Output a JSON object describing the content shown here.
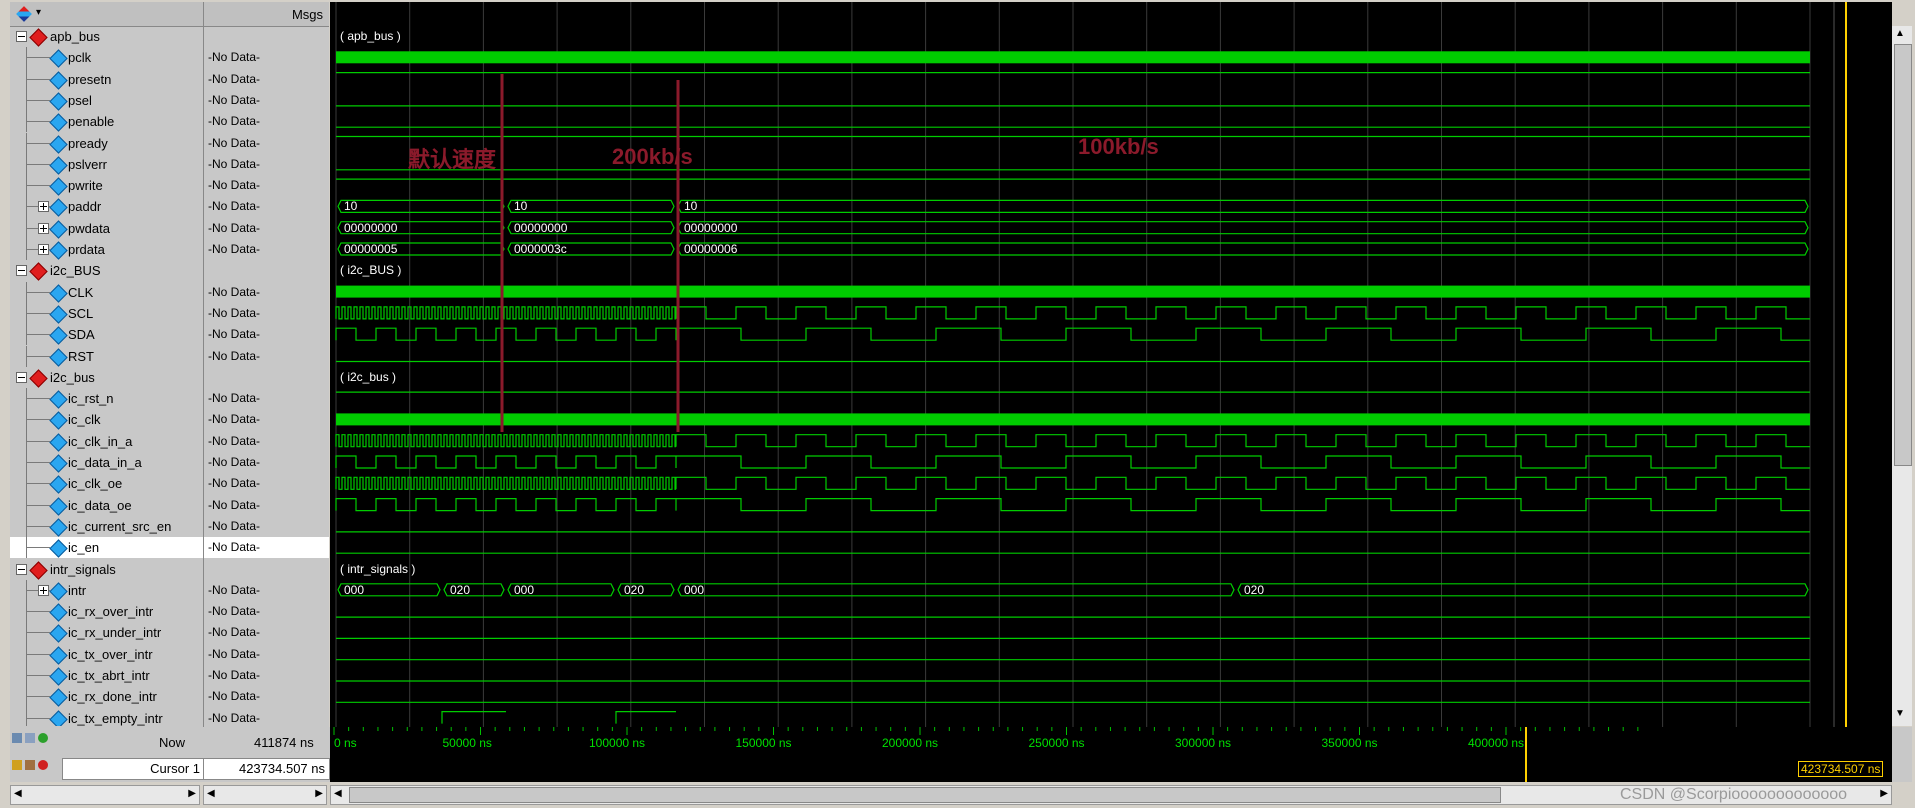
{
  "header": {
    "msgs_title": "Msgs"
  },
  "signals": [
    {
      "name": "apb_bus",
      "msg": "",
      "kind": "group",
      "expand": "minus",
      "indent": 0
    },
    {
      "name": "pclk",
      "msg": "-No Data-",
      "kind": "signal",
      "indent": 1
    },
    {
      "name": "presetn",
      "msg": "-No Data-",
      "kind": "signal",
      "indent": 1
    },
    {
      "name": "psel",
      "msg": "-No Data-",
      "kind": "signal",
      "indent": 1
    },
    {
      "name": "penable",
      "msg": "-No Data-",
      "kind": "signal",
      "indent": 1
    },
    {
      "name": "pready",
      "msg": "-No Data-",
      "kind": "signal",
      "indent": 1
    },
    {
      "name": "pslverr",
      "msg": "-No Data-",
      "kind": "signal",
      "indent": 1
    },
    {
      "name": "pwrite",
      "msg": "-No Data-",
      "kind": "signal",
      "indent": 1
    },
    {
      "name": "paddr",
      "msg": "-No Data-",
      "kind": "signal",
      "expand": "plus",
      "indent": 1
    },
    {
      "name": "pwdata",
      "msg": "-No Data-",
      "kind": "signal",
      "expand": "plus",
      "indent": 1
    },
    {
      "name": "prdata",
      "msg": "-No Data-",
      "kind": "signal",
      "expand": "plus",
      "indent": 1
    },
    {
      "name": "i2c_BUS",
      "msg": "",
      "kind": "group",
      "expand": "minus",
      "indent": 0
    },
    {
      "name": "CLK",
      "msg": "-No Data-",
      "kind": "signal",
      "indent": 1
    },
    {
      "name": "SCL",
      "msg": "-No Data-",
      "kind": "signal",
      "indent": 1
    },
    {
      "name": "SDA",
      "msg": "-No Data-",
      "kind": "signal",
      "indent": 1
    },
    {
      "name": "RST",
      "msg": "-No Data-",
      "kind": "signal",
      "indent": 1
    },
    {
      "name": "i2c_bus",
      "msg": "",
      "kind": "group",
      "expand": "minus",
      "indent": 0
    },
    {
      "name": "ic_rst_n",
      "msg": "-No Data-",
      "kind": "signal",
      "indent": 1
    },
    {
      "name": "ic_clk",
      "msg": "-No Data-",
      "kind": "signal",
      "indent": 1
    },
    {
      "name": "ic_clk_in_a",
      "msg": "-No Data-",
      "kind": "signal",
      "indent": 1
    },
    {
      "name": "ic_data_in_a",
      "msg": "-No Data-",
      "kind": "signal",
      "indent": 1
    },
    {
      "name": "ic_clk_oe",
      "msg": "-No Data-",
      "kind": "signal",
      "indent": 1
    },
    {
      "name": "ic_data_oe",
      "msg": "-No Data-",
      "kind": "signal",
      "indent": 1
    },
    {
      "name": "ic_current_src_en",
      "msg": "-No Data-",
      "kind": "signal",
      "indent": 1
    },
    {
      "name": "ic_en",
      "msg": "-No Data-",
      "kind": "signal",
      "indent": 1,
      "selected": true
    },
    {
      "name": "intr_signals",
      "msg": "",
      "kind": "group",
      "expand": "minus",
      "indent": 0
    },
    {
      "name": "intr",
      "msg": "-No Data-",
      "kind": "signal",
      "expand": "plus",
      "indent": 1
    },
    {
      "name": "ic_rx_over_intr",
      "msg": "-No Data-",
      "kind": "signal",
      "indent": 1
    },
    {
      "name": "ic_rx_under_intr",
      "msg": "-No Data-",
      "kind": "signal",
      "indent": 1
    },
    {
      "name": "ic_tx_over_intr",
      "msg": "-No Data-",
      "kind": "signal",
      "indent": 1
    },
    {
      "name": "ic_tx_abrt_intr",
      "msg": "-No Data-",
      "kind": "signal",
      "indent": 1
    },
    {
      "name": "ic_rx_done_intr",
      "msg": "-No Data-",
      "kind": "signal",
      "indent": 1
    },
    {
      "name": "ic_tx_empty_intr",
      "msg": "-No Data-",
      "kind": "signal",
      "indent": 1
    }
  ],
  "group_labels": {
    "apb_bus": "( apb_bus )",
    "i2c_BUS": "( i2c_BUS )",
    "i2c_bus": "( i2c_bus )",
    "intr_signals": "( intr_signals )"
  },
  "bus_values": {
    "paddr": [
      "10",
      "10",
      "10"
    ],
    "pwdata": [
      "00000000",
      "00000000",
      "00000000"
    ],
    "prdata": [
      "00000005",
      "0000003c",
      "00000006"
    ],
    "intr": [
      "000",
      "020",
      "000",
      "020",
      "000",
      "020"
    ]
  },
  "annotations": {
    "default_speed": "默认速度",
    "speed_200": "200kb/s",
    "speed_100": "100kb/s"
  },
  "annotation_color": "#8b1a2b",
  "status": {
    "now_label": "Now",
    "now_value": "411874 ns",
    "cursor_label": "Cursor 1",
    "cursor_value": "423734.507 ns",
    "cursor_tag": "423734.507 ns"
  },
  "timeline": {
    "ticks": [
      "0 ns",
      "50000 ns",
      "100000 ns",
      "150000 ns",
      "200000 ns",
      "250000 ns",
      "300000 ns",
      "350000 ns",
      "400000 ns"
    ]
  },
  "watermark": "CSDN @Scorpiooooooooooooo",
  "colors": {
    "wave": "#00cc00",
    "background": "#000000",
    "cursor": "#ffd000",
    "group_icon": "#e01e1e",
    "signal_icon": "#2aa6f0"
  }
}
